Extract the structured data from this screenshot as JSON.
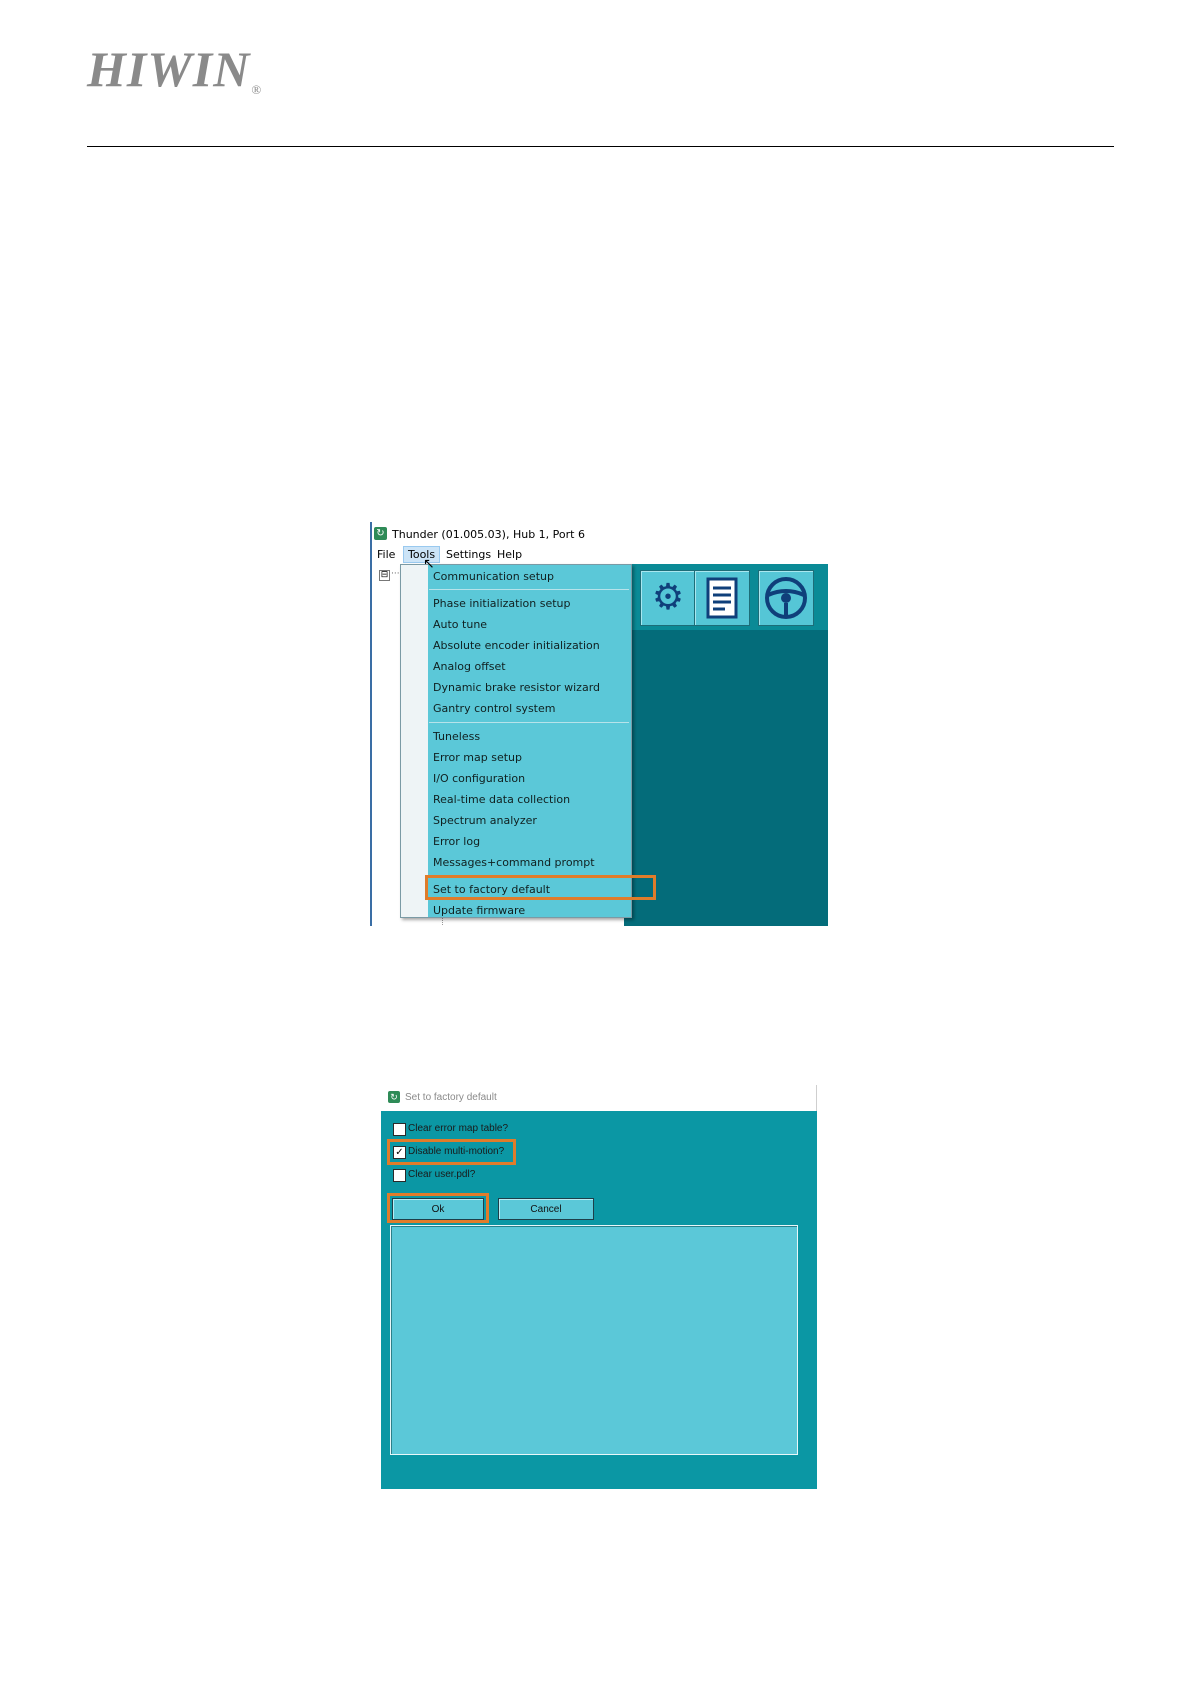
{
  "header": {
    "logo_text": "HIWIN",
    "logo_mark": "®"
  },
  "screenshot1": {
    "window_title": "Thunder (01.005.03), Hub 1, Port 6",
    "app_icon": "thunder-app-icon",
    "menubar": [
      "File",
      "Tools",
      "Settings",
      "Help"
    ],
    "tree_expander": "⊟",
    "tree_dots": "···",
    "toolbar_icons": [
      "gear-icon",
      "document-icon",
      "steering-wheel-icon"
    ],
    "tools_menu_items": [
      "Communication setup",
      "Phase initialization setup",
      "Auto tune",
      "Absolute encoder initialization",
      "Analog offset",
      "Dynamic brake resistor wizard",
      "Gantry control system",
      "Tuneless",
      "Error map setup",
      "I/O configuration",
      "Real-time data collection",
      "Spectrum analyzer",
      "Error log",
      "Messages+command prompt",
      "Set to factory default",
      "Update firmware"
    ],
    "highlighted_item": "Set to factory default",
    "highlight_color": "#e07c2a"
  },
  "screenshot2": {
    "dialog_title": "Set to factory default",
    "options": [
      {
        "label": "Clear error map table?",
        "checked": false
      },
      {
        "label": "Disable multi-motion?",
        "checked": true
      },
      {
        "label": "Clear user.pdl?",
        "checked": false
      }
    ],
    "buttons": {
      "ok": "Ok",
      "cancel": "Cancel"
    },
    "check_mark": "✓",
    "background_color": "#0b97a4"
  }
}
